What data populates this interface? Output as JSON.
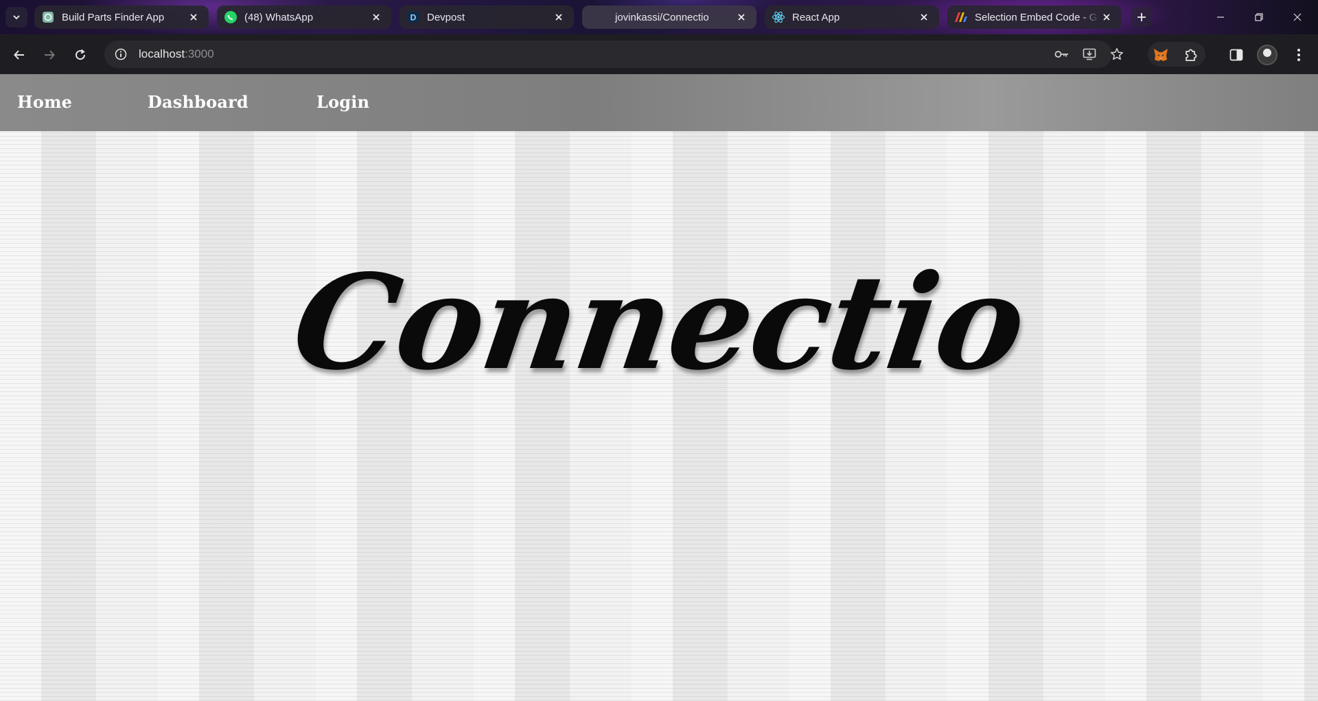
{
  "browser": {
    "tabs": [
      {
        "title": "Build Parts Finder App",
        "icon": "openai-icon",
        "active": false
      },
      {
        "title": "(48) WhatsApp",
        "icon": "whatsapp-icon",
        "active": false
      },
      {
        "title": "Devpost",
        "icon": "devpost-icon",
        "active": false
      },
      {
        "title": "jovinkassi/Connectio",
        "icon": "github-icon",
        "active": true
      },
      {
        "title": "React App",
        "icon": "react-icon",
        "active": false
      },
      {
        "title": "Selection Embed Code - G",
        "icon": "embed-app-icon",
        "active": false
      }
    ],
    "address": {
      "host": "localhost",
      "port": ":3000"
    }
  },
  "page": {
    "nav": {
      "home": "Home",
      "dashboard": "Dashboard",
      "login": "Login"
    },
    "hero_title": "Connectio"
  },
  "colors": {
    "navbar_bg": "#8a8a8a",
    "nav_text": "#ffffff",
    "hero_text": "#0a0a0a",
    "page_bg": "#ececec"
  }
}
